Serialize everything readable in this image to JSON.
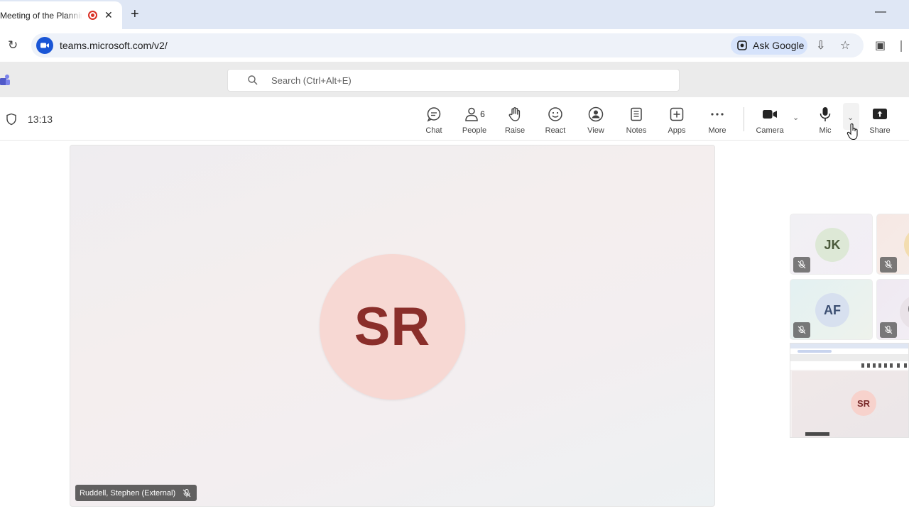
{
  "browser": {
    "tab_title": "Meeting of the Planning",
    "url": "teams.microsoft.com/v2/",
    "ask_google": "Ask Google"
  },
  "teams": {
    "search_placeholder": "Search (Ctrl+Alt+E)"
  },
  "meeting": {
    "timer": "13:13",
    "toolbar": {
      "chat": "Chat",
      "people": "People",
      "people_count": "6",
      "raise": "Raise",
      "react": "React",
      "view": "View",
      "notes": "Notes",
      "apps": "Apps",
      "more": "More",
      "camera": "Camera",
      "mic": "Mic",
      "share": "Share"
    },
    "main_participant": {
      "initials": "SR",
      "name": "Ruddell, Stephen (External)",
      "avatar_bg": "#f7d8d3",
      "initials_color": "#8a2e2a"
    },
    "gallery": [
      {
        "initials": "JK"
      },
      {
        "initials": "AF"
      }
    ],
    "shared_screen_initials": "SR"
  }
}
